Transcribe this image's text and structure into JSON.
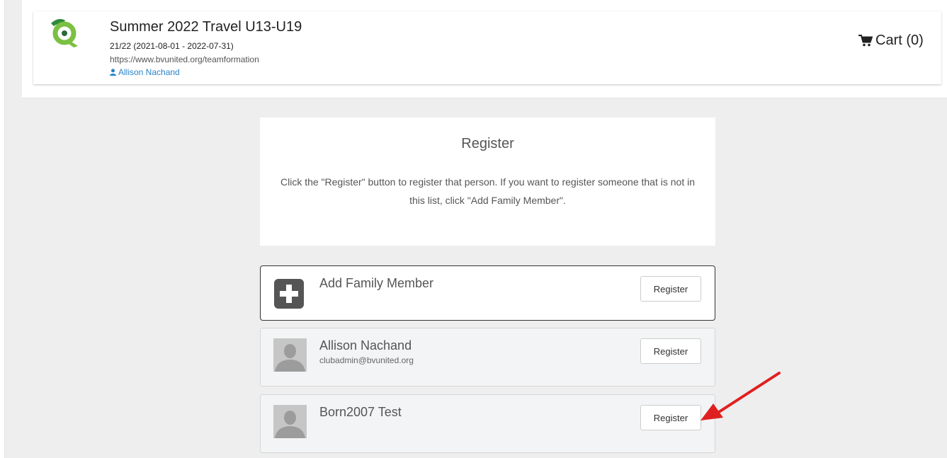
{
  "header": {
    "title": "Summer 2022 Travel U13-U19",
    "season": "21/22 (2021-08-01 - 2022-07-31)",
    "url": "https://www.bvunited.org/teamformation",
    "user": "Allison Nachand",
    "cart_label": "Cart (0)",
    "logo_icon": "club-logo-icon"
  },
  "intro": {
    "title": "Register",
    "text": "Click the \"Register\" button to register that person. If you want to register someone that is not in this list, click \"Add Family Member\"."
  },
  "add_member": {
    "label": "Add Family Member",
    "button_label": "Register"
  },
  "members": [
    {
      "name": "Allison Nachand",
      "email": "clubadmin@bvunited.org",
      "button_label": "Register"
    },
    {
      "name": "Born2007 Test",
      "email": "",
      "button_label": "Register"
    }
  ],
  "colors": {
    "brand_green": "#7bc043",
    "link_blue": "#2a84c8",
    "annotation_red": "#e02020"
  }
}
